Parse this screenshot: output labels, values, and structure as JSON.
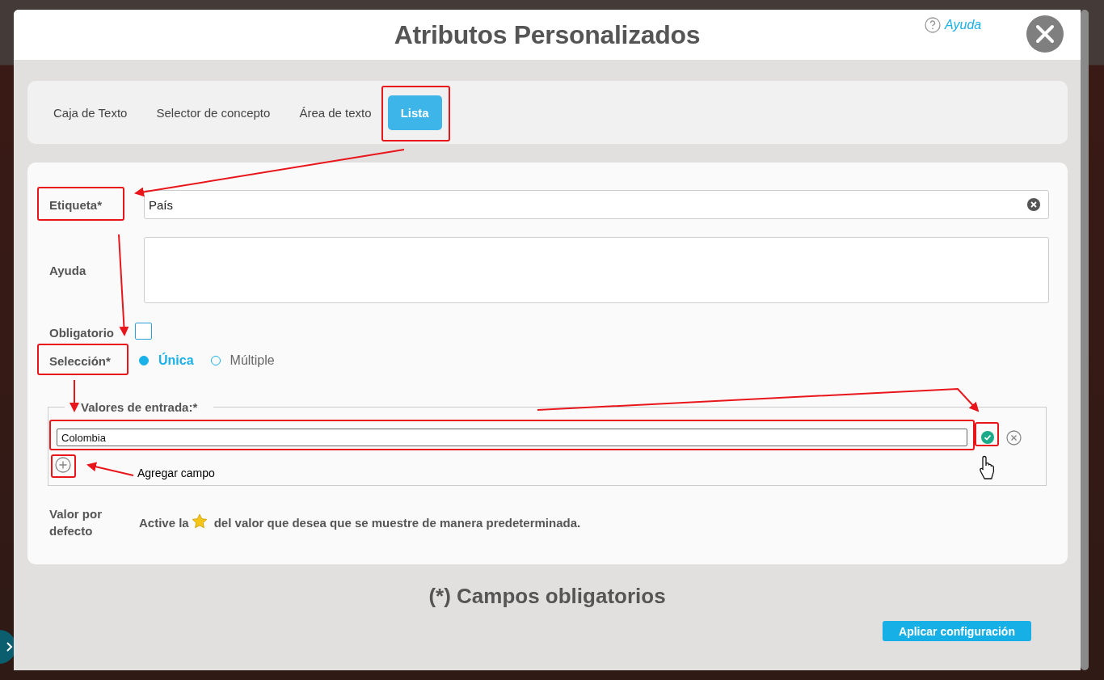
{
  "dialog": {
    "title": "Atributos Personalizados",
    "help_link": "Ayuda"
  },
  "tabs": [
    {
      "label": "Caja de Texto",
      "selected": false
    },
    {
      "label": "Selector de concepto",
      "selected": false
    },
    {
      "label": "Área de texto",
      "selected": false
    },
    {
      "label": "Lista",
      "selected": true
    }
  ],
  "form": {
    "label_field": {
      "label": "Etiqueta*",
      "value": "País"
    },
    "help_field": {
      "label": "Ayuda"
    },
    "required": {
      "label": "Obligatorio",
      "checked": false
    },
    "selection": {
      "label": "Selección*",
      "options": [
        {
          "label": "Única",
          "selected": true
        },
        {
          "label": "Múltiple",
          "selected": false
        }
      ]
    },
    "values": {
      "legend": "Valores de entrada:*",
      "entries": [
        {
          "value": "Colombia"
        }
      ]
    },
    "default_value": {
      "label": "Valor por defecto",
      "text_before": "Active la",
      "text_after": "del valor que desea que se muestre de manera predeterminada."
    }
  },
  "footer": {
    "note": "(*) Campos obligatorios",
    "apply_button": "Aplicar configuración"
  },
  "annotation": {
    "note": "Agregar campo"
  }
}
